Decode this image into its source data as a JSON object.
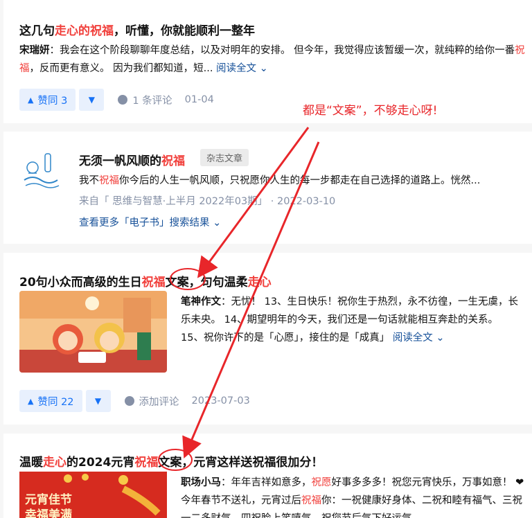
{
  "post1": {
    "title_pre": "这几句",
    "title_hl": "走心的祝福",
    "title_post": "，听懂，你就能顺利一整年",
    "author": "宋瑞妍",
    "excerpt_a": "：我会在这个阶段聊聊年度总结，以及对明年的安排。 但今年，我觉得应该暂缓一次，就纯粹的给你一番",
    "excerpt_hl": "祝福",
    "excerpt_b": "，反而更有意义。 因为我们都知道，短...",
    "read_more": "阅读全文",
    "upvote_label": "赞同 3",
    "comment_label": "1 条评论",
    "date": "01-04"
  },
  "post2": {
    "title_pre": "无须一帆风顺的",
    "title_hl": "祝福",
    "tag": "杂志文章",
    "excerpt_a": "我不",
    "excerpt_hl": "祝福",
    "excerpt_b": "你今后的人生一帆风顺，只祝愿你人生的每一步都走在自己选择的道路上。恍然...",
    "source": "来自「 思维与智慧·上半月 2022年03期」 · 2022-03-10",
    "more_results": "查看更多「电子书」搜索结果"
  },
  "post3": {
    "title_pre": "20句小众而高级的生日",
    "title_hl": "祝福",
    "title_mid": "文案",
    "title_post": "，句句温柔",
    "title_hl2": "走心",
    "author": "笔神作文",
    "excerpt": "：无忧！ 13、生日快乐！祝你生于热烈，永不彷徨，一生无虞，长乐未央。 14、期望明年的今天，我们还是一句话就能相互奔赴的关系。 15、祝你许下的是「心愿」，接住的是「成真」",
    "read_more": "阅读全文",
    "upvote_label": "赞同 22",
    "comment_label": "添加评论",
    "date": "2023-07-03"
  },
  "post4": {
    "title_pre": "温暖",
    "title_hl": "走心",
    "title_mid": "的2024元宵",
    "title_hl2": "祝福",
    "title_mid2": "文案",
    "title_post": "，元宵这样送祝福很加分！",
    "author": "职场小马",
    "excerpt_a": "：年年吉祥如意多，",
    "excerpt_hl": "祝愿",
    "excerpt_b": "好事多多多！祝您元宵快乐，万事如意！ ❤ 今年春节不送礼，元宵过后",
    "excerpt_hl2": "祝福",
    "excerpt_c": "你：一祝健康好身体、二祝和睦有福气、三祝一二多财气、四祝脸上笑嘻气、祝您节后气下好运气...",
    "thumb_text_1": "元宵佳节",
    "thumb_text_2": "幸福美满"
  },
  "annotation": "都是“文案”，不够走心呀!",
  "colors": {
    "highlight": "#f1403c",
    "link": "#175199",
    "accent": "#1772f6",
    "annotation": "#e8262a"
  }
}
